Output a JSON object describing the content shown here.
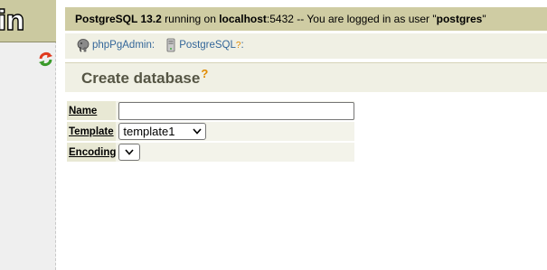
{
  "left_frame": {
    "logo_text": "in",
    "refresh_icon": "refresh-icon"
  },
  "topbar": {
    "server_name": "PostgreSQL 13.2",
    "running_on": " running on ",
    "host": "localhost",
    "port_and_text": ":5432 -- You are logged in as user \"",
    "user": "postgres",
    "quote_end": "\""
  },
  "trail": {
    "items": [
      {
        "label": "phpPgAdmin:",
        "icon": "elephant-icon"
      },
      {
        "label": "PostgreSQL",
        "help": "?",
        "sep": ":",
        "icon": "server-icon"
      }
    ]
  },
  "page": {
    "title": "Create database",
    "help": "?"
  },
  "form": {
    "name": {
      "label": "Name",
      "value": ""
    },
    "template": {
      "label": "Template",
      "selected": "template1"
    },
    "encoding": {
      "label": "Encoding",
      "selected": ""
    }
  },
  "colors": {
    "topbar_bg": "#cfcca3",
    "panel_bg": "#f0f0e4",
    "link": "#336699",
    "help_mark": "#e08a00"
  }
}
